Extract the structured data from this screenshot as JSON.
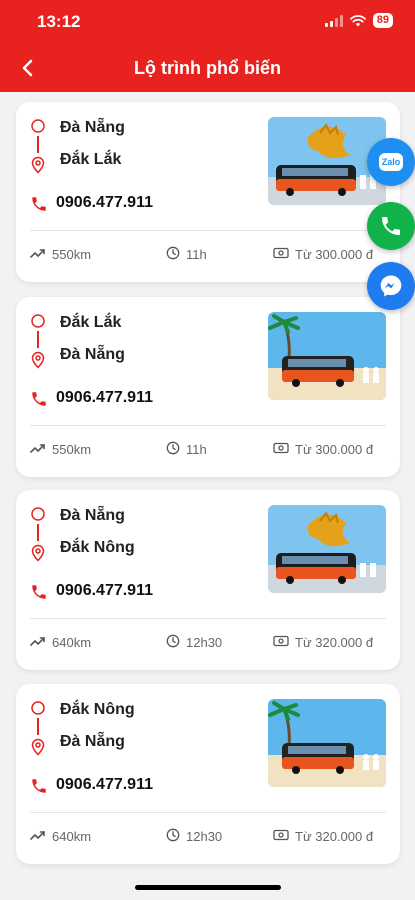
{
  "status": {
    "time": "13:12",
    "battery": "89"
  },
  "header": {
    "title": "Lộ trình phổ biến"
  },
  "routes": [
    {
      "from": "Đà Nẵng",
      "to": "Đắk Lắk",
      "phone": "0906.477.911",
      "distance": "550km",
      "duration": "11h",
      "price": "Từ 300.000 đ",
      "image": "dragon-bus"
    },
    {
      "from": "Đắk Lắk",
      "to": "Đà Nẵng",
      "phone": "0906.477.911",
      "distance": "550km",
      "duration": "11h",
      "price": "Từ 300.000 đ",
      "image": "beach-bus"
    },
    {
      "from": "Đà Nẵng",
      "to": "Đắk Nông",
      "phone": "0906.477.911",
      "distance": "640km",
      "duration": "12h30",
      "price": "Từ 320.000 đ",
      "image": "dragon-bus"
    },
    {
      "from": "Đắk Nông",
      "to": "Đà Nẵng",
      "phone": "0906.477.911",
      "distance": "640km",
      "duration": "12h30",
      "price": "Từ 320.000 đ",
      "image": "beach-bus"
    }
  ],
  "contact": {
    "zalo_label": "Zalo"
  },
  "colors": {
    "brand": "#e8231f",
    "zalo": "#1e8ff0",
    "call": "#12b24a",
    "messenger": "#1e7bf0"
  }
}
